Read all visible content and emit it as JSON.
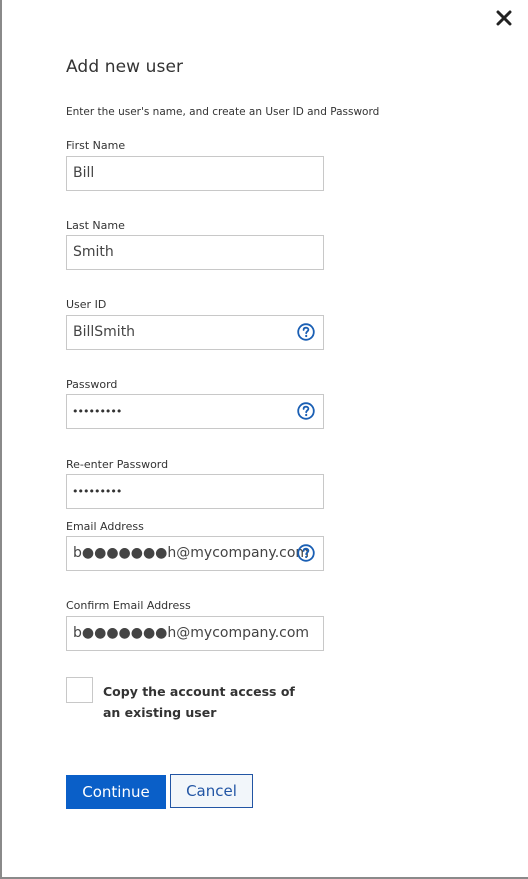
{
  "dialog": {
    "title": "Add new user",
    "instructions": "Enter the user's name, and create an User ID and Password",
    "close_icon": "close-icon"
  },
  "fields": {
    "first_name": {
      "label": "First Name",
      "value": "Bill"
    },
    "last_name": {
      "label": "Last Name",
      "value": "Smith"
    },
    "user_id": {
      "label": "User ID",
      "value": "BillSmith",
      "help_icon": "question-circle-icon"
    },
    "password": {
      "label": "Password",
      "value": "•••••••••",
      "help_icon": "question-circle-icon"
    },
    "reenter_password": {
      "label": "Re-enter Password",
      "value": "•••••••••"
    },
    "email": {
      "label": "Email Address",
      "value": "b●●●●●●●h@mycompany.com",
      "help_icon": "question-circle-icon"
    },
    "confirm_email": {
      "label": "Confirm Email Address",
      "value": "b●●●●●●●h@mycompany.com"
    }
  },
  "copy_access": {
    "label": "Copy the account access of an existing user",
    "checked": false
  },
  "buttons": {
    "continue": "Continue",
    "cancel": "Cancel"
  },
  "colors": {
    "primary": "#0a5fc8",
    "link": "#2255a4",
    "help": "#1a5fb4"
  }
}
